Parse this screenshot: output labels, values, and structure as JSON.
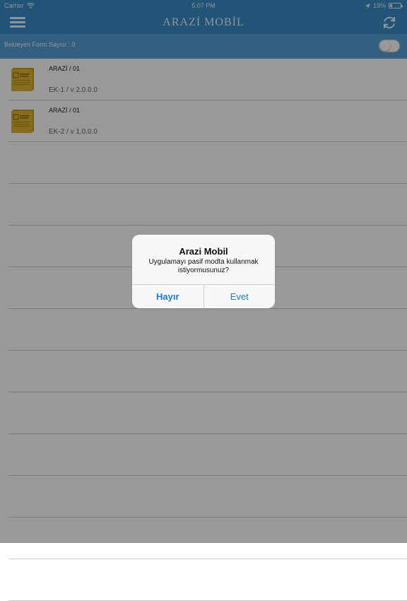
{
  "status_bar": {
    "carrier": "Carrier",
    "time": "5:07 PM",
    "battery": "19%",
    "battery_level": 0.19,
    "icons": [
      "wifi-icon",
      "location-arrow-icon",
      "battery-icon"
    ]
  },
  "header": {
    "title": "ARAZİ MOBİL",
    "icons": [
      "hamburger-menu-icon",
      "refresh-icon"
    ]
  },
  "pending": {
    "label": "Bekleyen Form Sayısı : 0",
    "toggle_on": false
  },
  "forms": [
    {
      "title": "ARAZİ / 01",
      "subtitle": "EK-1 / v 2.0.0.0",
      "icon": "document-folder-icon"
    },
    {
      "title": "ARAZİ / 01",
      "subtitle": "EK-2 / v 1.0.0.0",
      "icon": "document-folder-icon"
    }
  ],
  "alert": {
    "title": "Arazi Mobil",
    "message": "Uygulamayı pasif modta kullanmak istiyormusunuz?",
    "buttons": {
      "no": "Hayır",
      "yes": "Evet"
    }
  },
  "colors": {
    "nav": "#3a8cc6",
    "pending_bar": "#55a0d6",
    "alert_button": "#1a7ae6"
  }
}
